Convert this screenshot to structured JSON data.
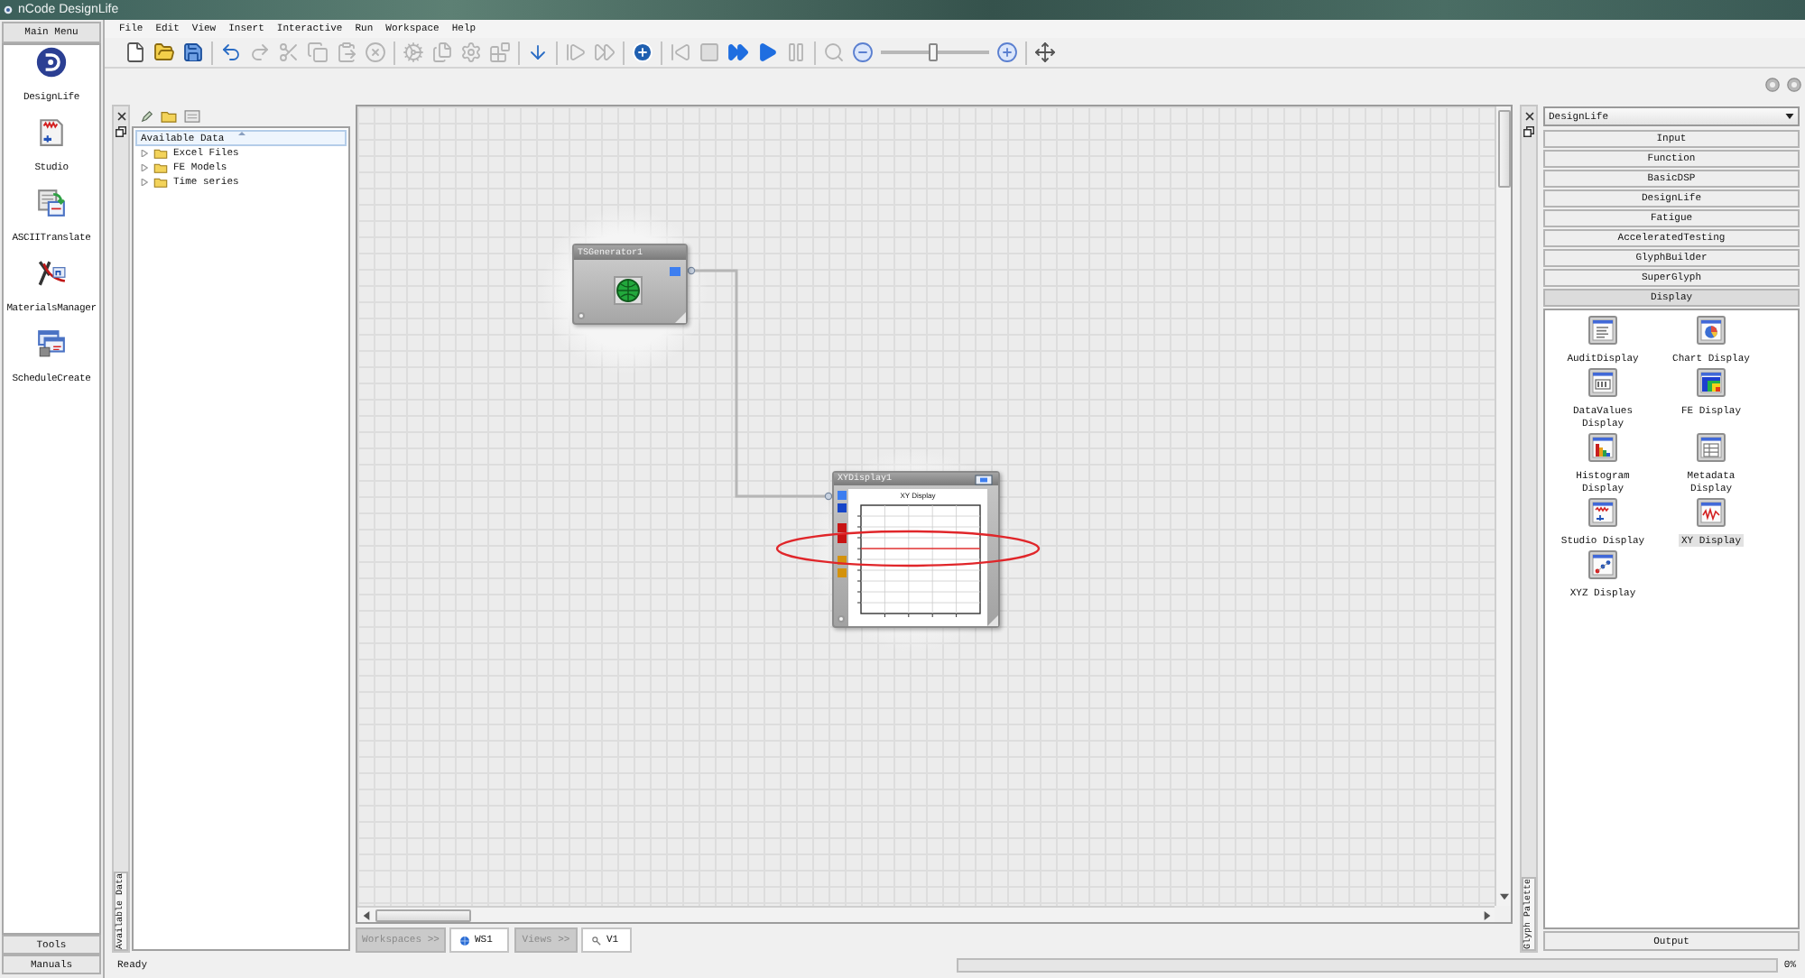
{
  "window": {
    "title": "nCode DesignLife"
  },
  "main_menu": {
    "title": "Main Menu",
    "items": [
      {
        "label": "DesignLife",
        "kind": "logo"
      },
      {
        "label": "Studio",
        "kind": "studio"
      },
      {
        "label": "ASCIITranslate",
        "kind": "translate"
      },
      {
        "label": "MaterialsManager",
        "kind": "materials"
      },
      {
        "label": "ScheduleCreate",
        "kind": "schedule"
      }
    ],
    "footer_buttons": [
      "Tools",
      "Manuals"
    ]
  },
  "menu_bar": [
    "File",
    "Edit",
    "View",
    "Insert",
    "Interactive",
    "Run",
    "Workspace",
    "Help"
  ],
  "toolbar": [
    {
      "kind": "new",
      "disabled": false
    },
    {
      "kind": "open",
      "disabled": false
    },
    {
      "kind": "save",
      "disabled": false
    },
    {
      "kind": "separator"
    },
    {
      "kind": "undo",
      "disabled": false
    },
    {
      "kind": "redo",
      "disabled": true
    },
    {
      "kind": "cut",
      "disabled": true
    },
    {
      "kind": "copy",
      "disabled": true
    },
    {
      "kind": "paste",
      "disabled": true
    },
    {
      "kind": "delete",
      "disabled": true
    },
    {
      "kind": "separator"
    },
    {
      "kind": "cog",
      "disabled": true
    },
    {
      "kind": "documents",
      "disabled": true
    },
    {
      "kind": "gear",
      "disabled": true
    },
    {
      "kind": "blocks",
      "disabled": true
    },
    {
      "kind": "separator"
    },
    {
      "kind": "down",
      "disabled": false
    },
    {
      "kind": "separator"
    },
    {
      "kind": "step",
      "disabled": true
    },
    {
      "kind": "forward",
      "disabled": true
    },
    {
      "kind": "separator"
    },
    {
      "kind": "add",
      "disabled": false
    },
    {
      "kind": "separator"
    },
    {
      "kind": "rewind",
      "disabled": true
    },
    {
      "kind": "stop",
      "disabled": true
    },
    {
      "kind": "advance",
      "disabled": false
    },
    {
      "kind": "play",
      "disabled": false
    },
    {
      "kind": "pause",
      "disabled": true
    },
    {
      "kind": "separator"
    },
    {
      "kind": "magnifier",
      "disabled": true
    },
    {
      "kind": "zoomout",
      "disabled": false
    },
    {
      "kind": "slider",
      "level": 0.48
    },
    {
      "kind": "zoomin",
      "disabled": false
    },
    {
      "kind": "separator"
    },
    {
      "kind": "fit",
      "disabled": false
    }
  ],
  "data_panel": {
    "dock_label": "Available Data",
    "header": "Available Data",
    "items": [
      {
        "label": "Excel Files",
        "expanded": false
      },
      {
        "label": "FE Models",
        "expanded": false
      },
      {
        "label": "Time series",
        "expanded": false
      }
    ]
  },
  "canvas": {
    "nodes": [
      {
        "title": "TSGenerator1",
        "kind": "generator",
        "ports": [
          {
            "color": "#3d7ef0"
          }
        ]
      },
      {
        "title": "XYDisplay1",
        "kind": "display",
        "chart_title": "XY Display",
        "ports": [
          {
            "color": "#3d7ef0"
          },
          {
            "color": "#1746c8"
          },
          {
            "color": "#c81414"
          },
          {
            "color": "#c81414"
          },
          {
            "color": "#d4920c"
          },
          {
            "color": "#d4920c"
          }
        ]
      }
    ]
  },
  "workspace_bar": {
    "workspaces_button": "Workspaces >>",
    "workspaces": [
      {
        "label": "WS1",
        "selected": true
      }
    ],
    "views_button": "Views >>",
    "views": [
      {
        "label": "V1",
        "selected": true
      }
    ]
  },
  "glyph_palette": {
    "dock_label": "Glyph Palette",
    "library": "DesignLife",
    "categories": [
      {
        "label": "Input",
        "expanded": false
      },
      {
        "label": "Function",
        "expanded": false
      },
      {
        "label": "BasicDSP",
        "expanded": false
      },
      {
        "label": "DesignLife",
        "expanded": false
      },
      {
        "label": "Fatigue",
        "expanded": false
      },
      {
        "label": "AcceleratedTesting",
        "expanded": false
      },
      {
        "label": "GlyphBuilder",
        "expanded": false
      },
      {
        "label": "SuperGlyph",
        "expanded": false
      },
      {
        "label": "Display",
        "expanded": true
      }
    ],
    "glyphs": [
      {
        "label": "AuditDisplay",
        "kind": "audit",
        "selected": false
      },
      {
        "label": "Chart Display",
        "kind": "chart",
        "selected": false
      },
      {
        "label": "DataValues Display",
        "kind": "values",
        "selected": false
      },
      {
        "label": "FE Display",
        "kind": "fe",
        "selected": false
      },
      {
        "label": "Histogram Display",
        "kind": "histogram",
        "selected": false
      },
      {
        "label": "Metadata Display",
        "kind": "metadata",
        "selected": false
      },
      {
        "label": "Studio Display",
        "kind": "studio",
        "selected": false
      },
      {
        "label": "XY Display",
        "kind": "xy",
        "selected": true
      },
      {
        "label": "XYZ Display",
        "kind": "xyz",
        "selected": false
      }
    ],
    "footer": "Output"
  },
  "status_bar": {
    "message": "Ready",
    "progress": {
      "level": 0,
      "reading": "0%"
    }
  }
}
